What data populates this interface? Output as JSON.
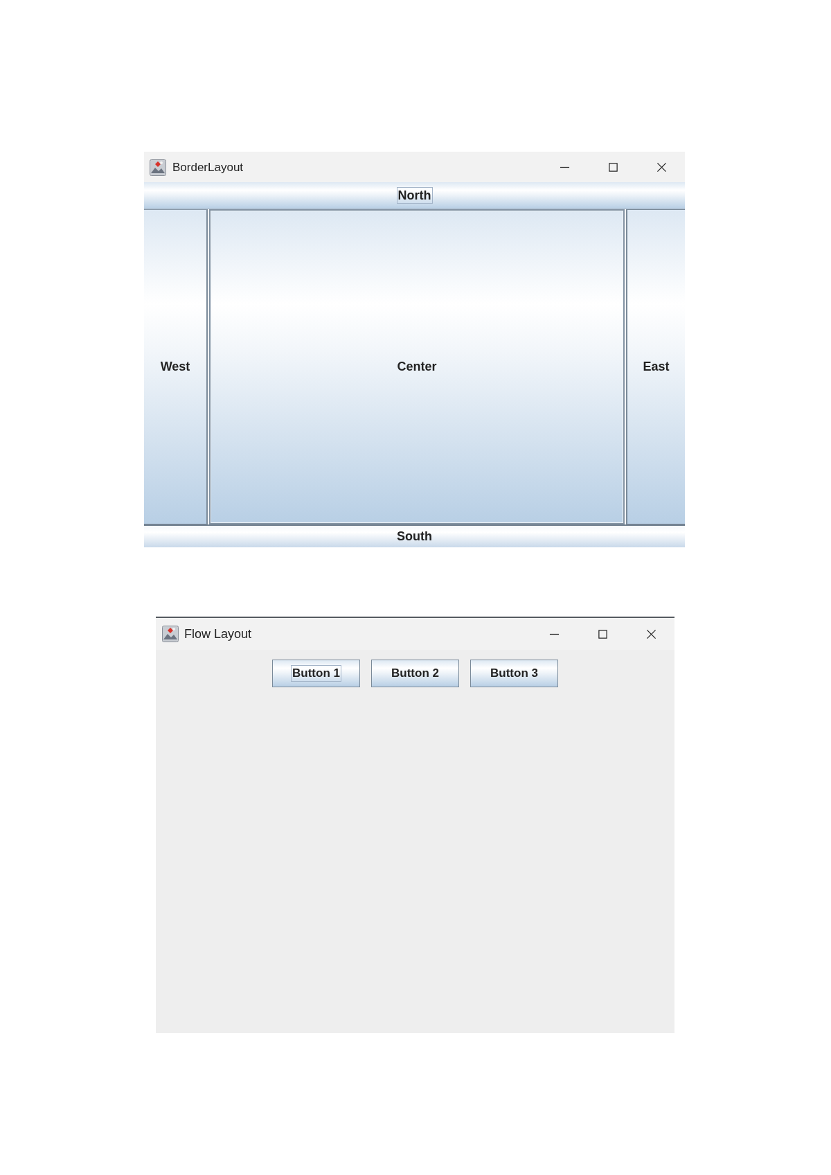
{
  "windows": [
    {
      "kind": "border_layout",
      "title": "BorderLayout",
      "regions": {
        "north": {
          "label": "North",
          "focused": true
        },
        "west": {
          "label": "West",
          "focused": false
        },
        "center": {
          "label": "Center",
          "focused": false
        },
        "east": {
          "label": "East",
          "focused": false
        },
        "south": {
          "label": "South",
          "focused": false
        }
      }
    },
    {
      "kind": "flow_layout",
      "title": "Flow Layout",
      "buttons": [
        {
          "label": "Button 1",
          "focused": true
        },
        {
          "label": "Button 2",
          "focused": false
        },
        {
          "label": "Button 3",
          "focused": false
        }
      ]
    }
  ]
}
